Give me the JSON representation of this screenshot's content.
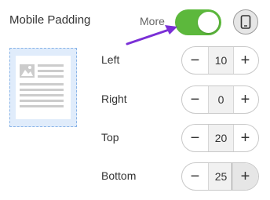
{
  "header": {
    "title": "Mobile Padding",
    "more_label": "More",
    "toggle_on": true,
    "device_icon": "phone-icon"
  },
  "colors": {
    "toggle_on": "#5cb83c",
    "arrow": "#7a2fd6",
    "preview_bg": "#e0ecfb",
    "preview_border": "#89b4e8"
  },
  "padding": [
    {
      "label": "Left",
      "value": "10"
    },
    {
      "label": "Right",
      "value": "0"
    },
    {
      "label": "Top",
      "value": "20"
    },
    {
      "label": "Bottom",
      "value": "25"
    }
  ],
  "stepper": {
    "minus": "−",
    "plus": "+"
  }
}
